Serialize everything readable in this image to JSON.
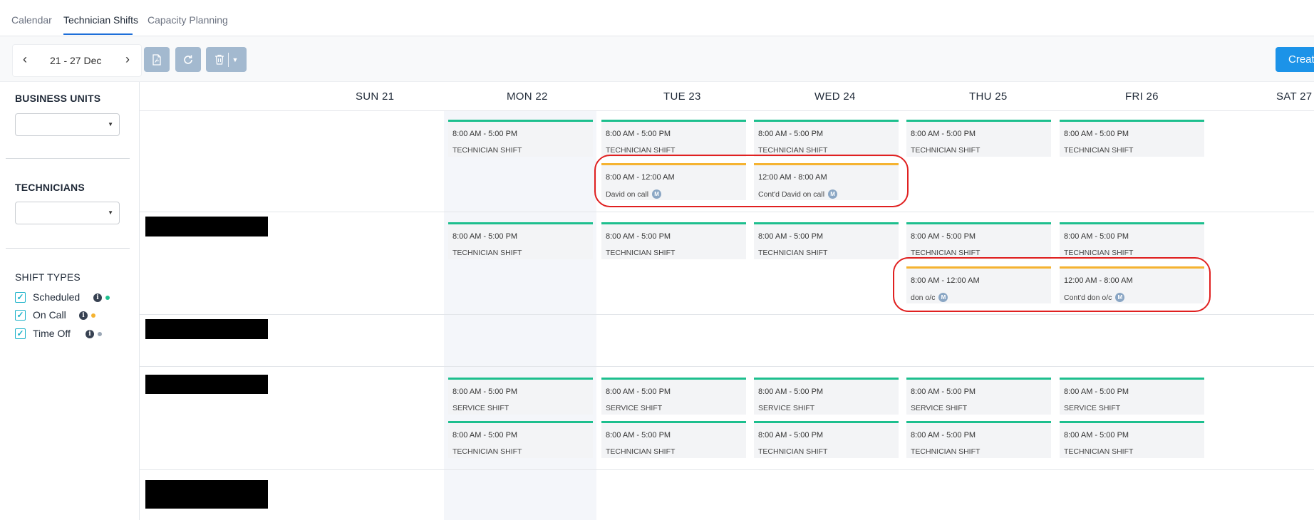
{
  "tabs": [
    {
      "label": "Calendar"
    },
    {
      "label": "Technician Shifts"
    },
    {
      "label": "Capacity Planning"
    }
  ],
  "toolbar": {
    "date_range": "21 - 27 Dec",
    "prev_icon": "chevron-left-icon",
    "next_icon": "chevron-right-icon",
    "create_label": "Create"
  },
  "sidebar": {
    "business_units_title": "BUSINESS UNITS",
    "technicians_title": "TECHNICIANS",
    "shift_types_title": "SHIFT TYPES",
    "shift_types": [
      {
        "label": "Scheduled",
        "checked": true,
        "color": "#1dbf8e"
      },
      {
        "label": "On Call",
        "checked": true,
        "color": "#f5b331"
      },
      {
        "label": "Time Off",
        "checked": true,
        "color": "#9aa7b5"
      }
    ]
  },
  "days": [
    "SUN 21",
    "MON 22",
    "TUE 23",
    "WED 24",
    "THU 25",
    "FRI 26",
    "SAT 27"
  ],
  "colors": {
    "scheduled": "#1dbf8e",
    "on_call": "#f5b331",
    "highlight": "#e02020"
  },
  "shifts": {
    "r1_mon": {
      "time": "8:00 AM - 5:00 PM",
      "label": "TECHNICIAN SHIFT"
    },
    "r1_tue": {
      "time": "8:00 AM - 5:00 PM",
      "label": "TECHNICIAN SHIFT"
    },
    "r1_wed": {
      "time": "8:00 AM - 5:00 PM",
      "label": "TECHNICIAN SHIFT"
    },
    "r1_thu": {
      "time": "8:00 AM - 5:00 PM",
      "label": "TECHNICIAN SHIFT"
    },
    "r1_fri": {
      "time": "8:00 AM - 5:00 PM",
      "label": "TECHNICIAN SHIFT"
    },
    "r1_oncall_tue": {
      "time": "8:00 AM - 12:00 AM",
      "label": "David on call",
      "badge": "M"
    },
    "r1_oncall_wed": {
      "time": "12:00 AM - 8:00 AM",
      "label": "Cont'd David on call",
      "badge": "M"
    },
    "r2_mon": {
      "time": "8:00 AM - 5:00 PM",
      "label": "TECHNICIAN SHIFT"
    },
    "r2_tue": {
      "time": "8:00 AM - 5:00 PM",
      "label": "TECHNICIAN SHIFT"
    },
    "r2_wed": {
      "time": "8:00 AM - 5:00 PM",
      "label": "TECHNICIAN SHIFT"
    },
    "r2_thu": {
      "time": "8:00 AM - 5:00 PM",
      "label": "TECHNICIAN SHIFT"
    },
    "r2_fri": {
      "time": "8:00 AM - 5:00 PM",
      "label": "TECHNICIAN SHIFT"
    },
    "r2_oncall_thu": {
      "time": "8:00 AM - 12:00 AM",
      "label": "don o/c",
      "badge": "M"
    },
    "r2_oncall_fri": {
      "time": "12:00 AM - 8:00 AM",
      "label": "Cont'd don o/c",
      "badge": "M"
    },
    "r4_svc_mon": {
      "time": "8:00 AM - 5:00 PM",
      "label": "SERVICE SHIFT"
    },
    "r4_svc_tue": {
      "time": "8:00 AM - 5:00 PM",
      "label": "SERVICE SHIFT"
    },
    "r4_svc_wed": {
      "time": "8:00 AM - 5:00 PM",
      "label": "SERVICE SHIFT"
    },
    "r4_svc_thu": {
      "time": "8:00 AM - 5:00 PM",
      "label": "SERVICE SHIFT"
    },
    "r4_svc_fri": {
      "time": "8:00 AM - 5:00 PM",
      "label": "SERVICE SHIFT"
    },
    "r4_tech_mon": {
      "time": "8:00 AM - 5:00 PM",
      "label": "TECHNICIAN SHIFT"
    },
    "r4_tech_tue": {
      "time": "8:00 AM - 5:00 PM",
      "label": "TECHNICIAN SHIFT"
    },
    "r4_tech_wed": {
      "time": "8:00 AM - 5:00 PM",
      "label": "TECHNICIAN SHIFT"
    },
    "r4_tech_thu": {
      "time": "8:00 AM - 5:00 PM",
      "label": "TECHNICIAN SHIFT"
    },
    "r4_tech_fri": {
      "time": "8:00 AM - 5:00 PM",
      "label": "TECHNICIAN SHIFT"
    }
  }
}
